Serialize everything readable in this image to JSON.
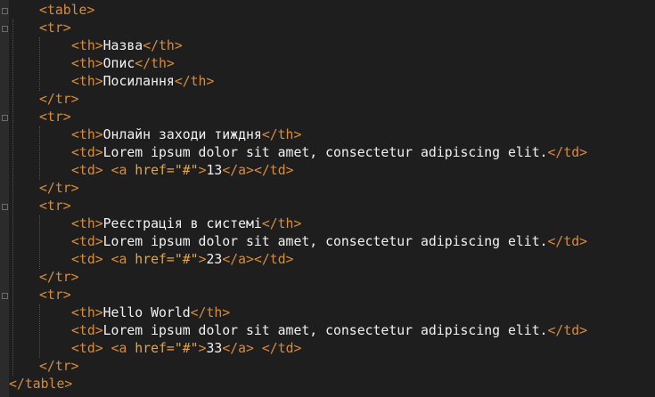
{
  "editor": {
    "lines": [
      {
        "indent": 1,
        "parts": [
          [
            "t",
            "<table>"
          ]
        ]
      },
      {
        "indent": 1,
        "parts": [
          [
            "t",
            "<tr>"
          ]
        ]
      },
      {
        "indent": 2,
        "parts": [
          [
            "t",
            "<th>"
          ],
          [
            "txt",
            "Назва"
          ],
          [
            "t",
            "</th>"
          ]
        ]
      },
      {
        "indent": 2,
        "parts": [
          [
            "t",
            "<th>"
          ],
          [
            "txt",
            "Опис"
          ],
          [
            "t",
            "</th>"
          ]
        ]
      },
      {
        "indent": 2,
        "parts": [
          [
            "t",
            "<th>"
          ],
          [
            "txt",
            "Посилання"
          ],
          [
            "t",
            "</th>"
          ]
        ]
      },
      {
        "indent": 1,
        "parts": [
          [
            "t",
            "</tr>"
          ]
        ]
      },
      {
        "indent": 1,
        "parts": [
          [
            "t",
            "<tr>"
          ]
        ]
      },
      {
        "indent": 2,
        "parts": [
          [
            "t",
            "<th>"
          ],
          [
            "txt",
            "Онлайн заходи тиждня"
          ],
          [
            "t",
            "</th>"
          ]
        ]
      },
      {
        "indent": 2,
        "parts": [
          [
            "t",
            "<td>"
          ],
          [
            "txt",
            "Lorem ipsum dolor sit amet, consectetur adipiscing elit."
          ],
          [
            "t",
            "</td>"
          ]
        ]
      },
      {
        "indent": 2,
        "parts": [
          [
            "t",
            "<td>"
          ],
          [
            "txt",
            " "
          ],
          [
            "t",
            "<a "
          ],
          [
            "a",
            "href=\"#\""
          ],
          [
            "t",
            ">"
          ],
          [
            "txt",
            "13"
          ],
          [
            "t",
            "</a>"
          ],
          [
            "t",
            "</td>"
          ]
        ]
      },
      {
        "indent": 1,
        "parts": [
          [
            "t",
            "</tr>"
          ]
        ]
      },
      {
        "indent": 1,
        "parts": [
          [
            "t",
            "<tr>"
          ]
        ]
      },
      {
        "indent": 2,
        "parts": [
          [
            "t",
            "<th>"
          ],
          [
            "txt",
            "Реєстрація в системі"
          ],
          [
            "t",
            "</th>"
          ]
        ]
      },
      {
        "indent": 2,
        "parts": [
          [
            "t",
            "<td>"
          ],
          [
            "txt",
            "Lorem ipsum dolor sit amet, consectetur adipiscing elit."
          ],
          [
            "t",
            "</td>"
          ]
        ]
      },
      {
        "indent": 2,
        "parts": [
          [
            "t",
            "<td>"
          ],
          [
            "txt",
            " "
          ],
          [
            "t",
            "<a "
          ],
          [
            "a",
            "href=\"#\""
          ],
          [
            "t",
            ">"
          ],
          [
            "txt",
            "23"
          ],
          [
            "t",
            "</a>"
          ],
          [
            "t",
            "</td>"
          ]
        ]
      },
      {
        "indent": 1,
        "parts": [
          [
            "t",
            "</tr>"
          ]
        ]
      },
      {
        "indent": 1,
        "parts": [
          [
            "t",
            "<tr>"
          ]
        ]
      },
      {
        "indent": 2,
        "parts": [
          [
            "t",
            "<th>"
          ],
          [
            "txt",
            "Hello World"
          ],
          [
            "t",
            "</th>"
          ]
        ]
      },
      {
        "indent": 2,
        "parts": [
          [
            "t",
            "<td>"
          ],
          [
            "txt",
            "Lorem ipsum dolor sit amet, consectetur adipiscing elit."
          ],
          [
            "t",
            "</td>"
          ]
        ]
      },
      {
        "indent": 2,
        "parts": [
          [
            "t",
            "<td>"
          ],
          [
            "txt",
            " "
          ],
          [
            "t",
            "<a "
          ],
          [
            "a",
            "href=\"#\""
          ],
          [
            "t",
            ">"
          ],
          [
            "txt",
            "33"
          ],
          [
            "t",
            "</a>"
          ],
          [
            "txt",
            " "
          ],
          [
            "t",
            "</td>"
          ]
        ]
      },
      {
        "indent": 1,
        "parts": [
          [
            "t",
            "</tr>"
          ]
        ]
      },
      {
        "indent": 0,
        "parts": [
          [
            "t",
            "</table>"
          ]
        ]
      }
    ]
  },
  "colors": {
    "background": "#1e1e1e",
    "tag": "#d98c3b",
    "attribute": "#e0a64a",
    "text": "#f2f2f2"
  }
}
